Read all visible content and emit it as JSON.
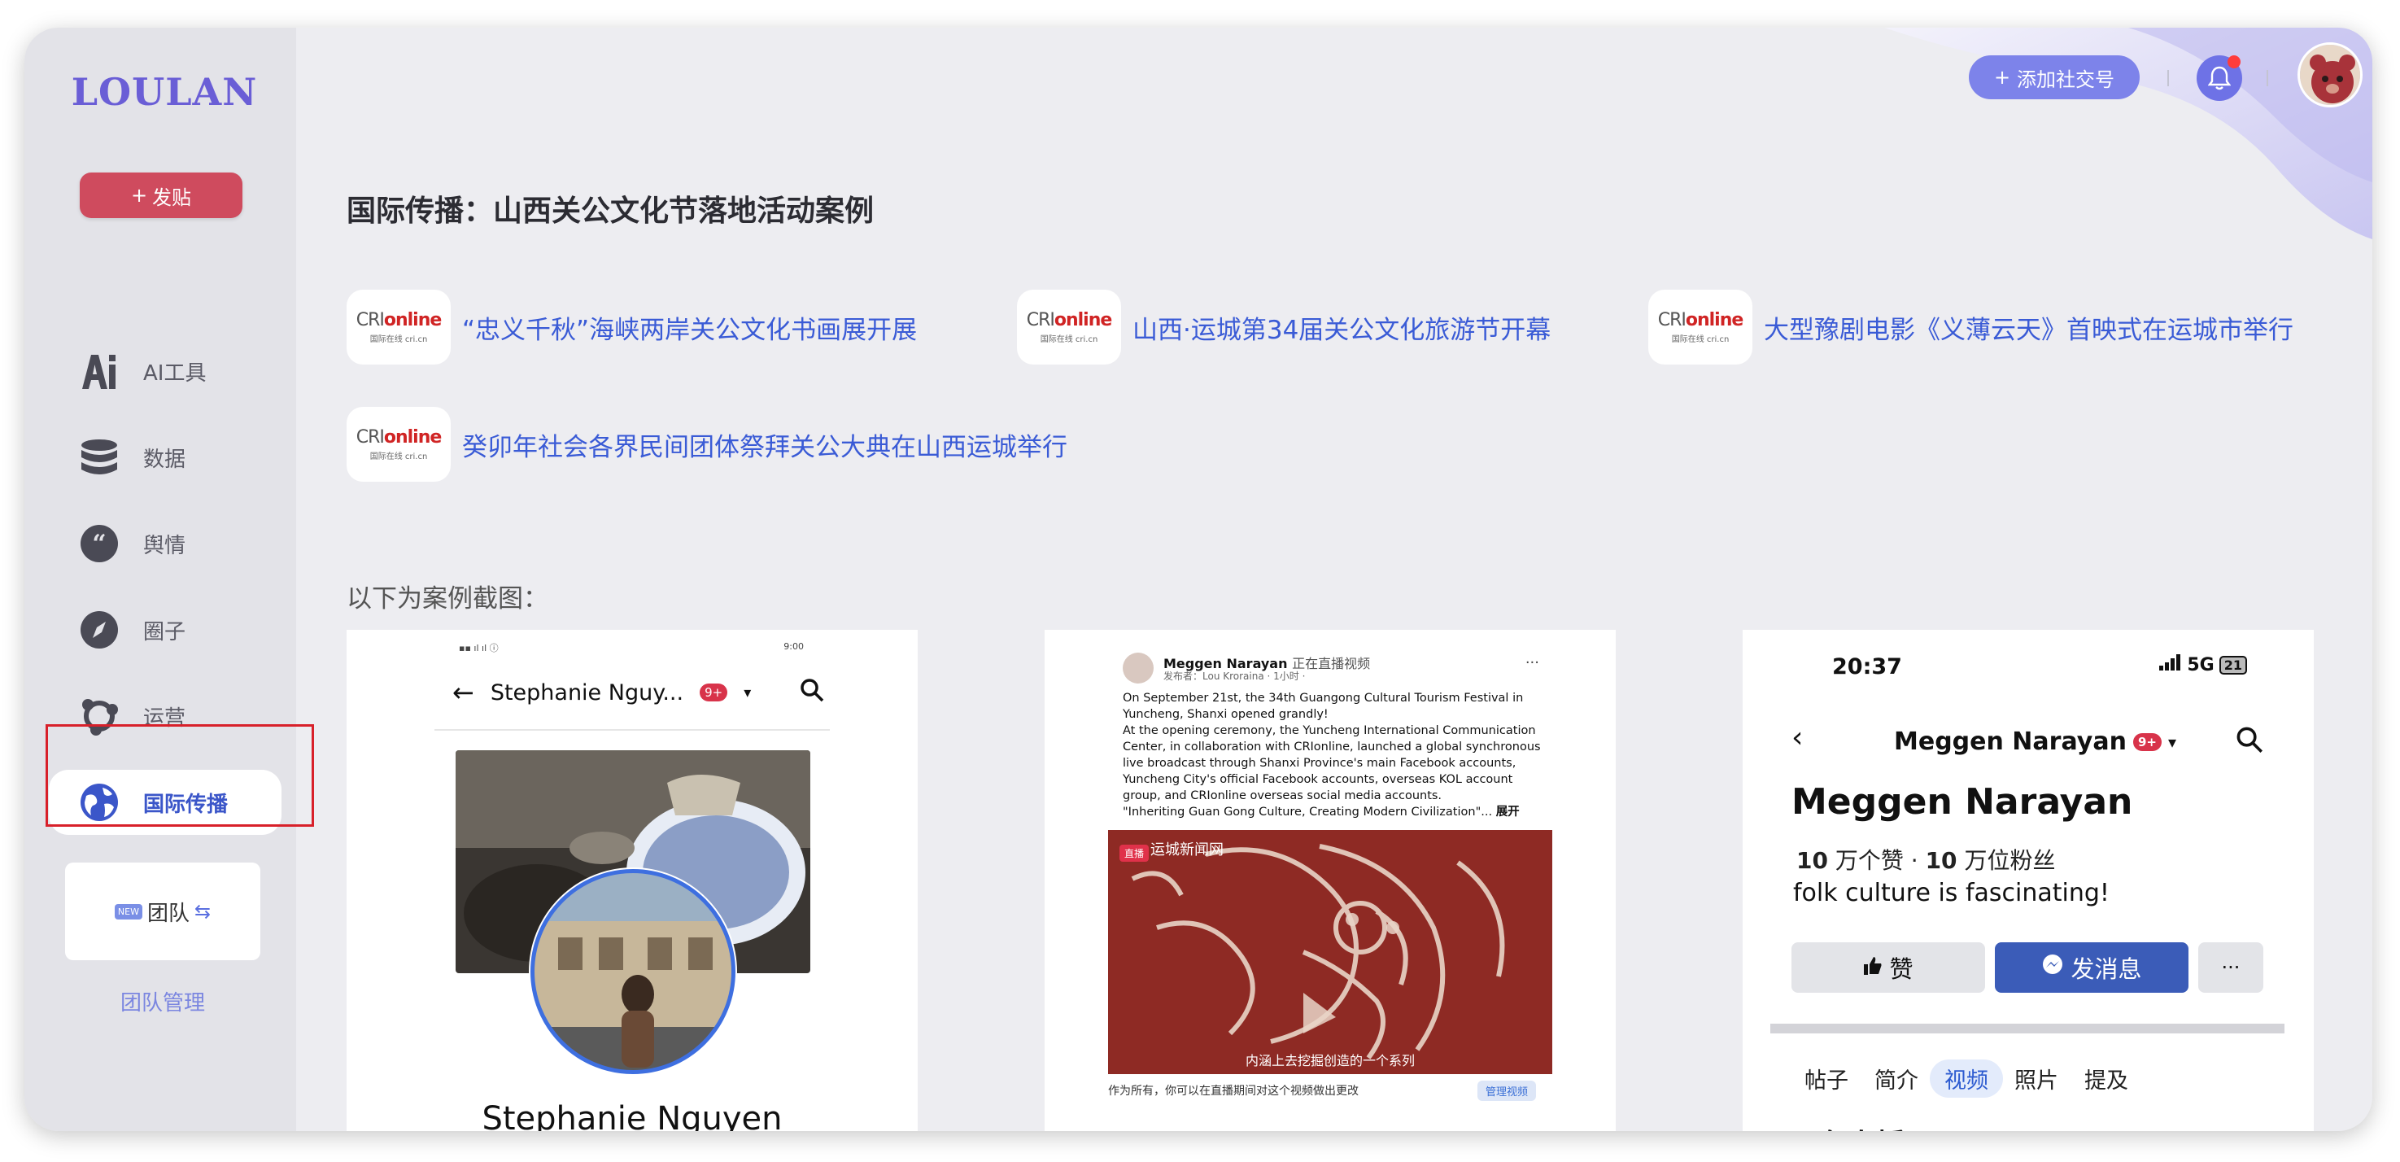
{
  "brand": {
    "logo_text": "LOULAN"
  },
  "sidebar": {
    "post_button": "发贴",
    "items": [
      {
        "label": "AI工具",
        "icon": "ai-icon"
      },
      {
        "label": "数据",
        "icon": "database-icon"
      },
      {
        "label": "舆情",
        "icon": "quote-icon"
      },
      {
        "label": "圈子",
        "icon": "compass-icon"
      },
      {
        "label": "运营",
        "icon": "network-icon"
      },
      {
        "label": "国际传播",
        "icon": "globe-icon",
        "active": true
      }
    ],
    "team_badge": "NEW",
    "team_label": "团队",
    "team_manage": "团队管理"
  },
  "header": {
    "add_social": "添加社交号",
    "accent": "#7d83ea"
  },
  "main": {
    "title": "国际传播：山西关公文化节落地活动案例",
    "source_logo": {
      "main_a": "CRI",
      "main_b": "online",
      "sub": "国际在线 cri.cn"
    },
    "links": [
      "“忠义千秋”海峡两岸关公文化书画展开展",
      "山西·运城第34届关公文化旅游节开幕",
      "大型豫剧电影《义薄云天》首映式在运城市举行",
      "癸卯年社会各界民间团体祭拜关公大典在山西运城举行"
    ],
    "screenshots_label": "以下为案例截图："
  },
  "shot1": {
    "time": "9:00",
    "profile_name_header": "Stephanie Nguy...",
    "badge": "9+",
    "profile_name": "Stephanie Nguyen"
  },
  "shot2": {
    "author": "Meggen Narayan",
    "live_note": "正在直播视频",
    "meta": "发布者：Lou Kroraina · 1小时 ·",
    "body": "On September 21st, the 34th Guangong Cultural Tourism Festival in Yuncheng, Shanxi  opened grandly!\nAt the opening ceremony, the Yuncheng International Communication Center, in collaboration with CRIonline, launched a global synchronous live broadcast through Shanxi Province's main Facebook accounts, Yuncheng City's official Facebook accounts, overseas KOL account group, and CRIonline overseas social media accounts.\n\"Inheriting Guan Gong Culture, Creating Modern Civilization\"...",
    "expand": "展开",
    "live_tag": "直播",
    "source": "运城新闻网",
    "caption": "内涵上去挖掘创造的一个系列",
    "bottom_text": "作为所有，你可以在直播期间对这个视频做出更改",
    "bottom_button": "管理视频"
  },
  "shot3": {
    "time": "20:37",
    "network": "5G",
    "battery": "21",
    "header_name": "Meggen Narayan",
    "badge": "9+",
    "name": "Meggen Narayan",
    "likes_num": "10",
    "likes_label": "万个赞 · ",
    "followers_num": "10",
    "followers_label": "万位粉丝",
    "bio": "folk culture is fascinating!",
    "like_button": "赞",
    "message_button": "发消息",
    "more_button": "···",
    "tabs": [
      "帖子",
      "简介",
      "视频",
      "照片",
      "提及"
    ],
    "active_tab": "视频",
    "live_heading": "正在直播"
  }
}
